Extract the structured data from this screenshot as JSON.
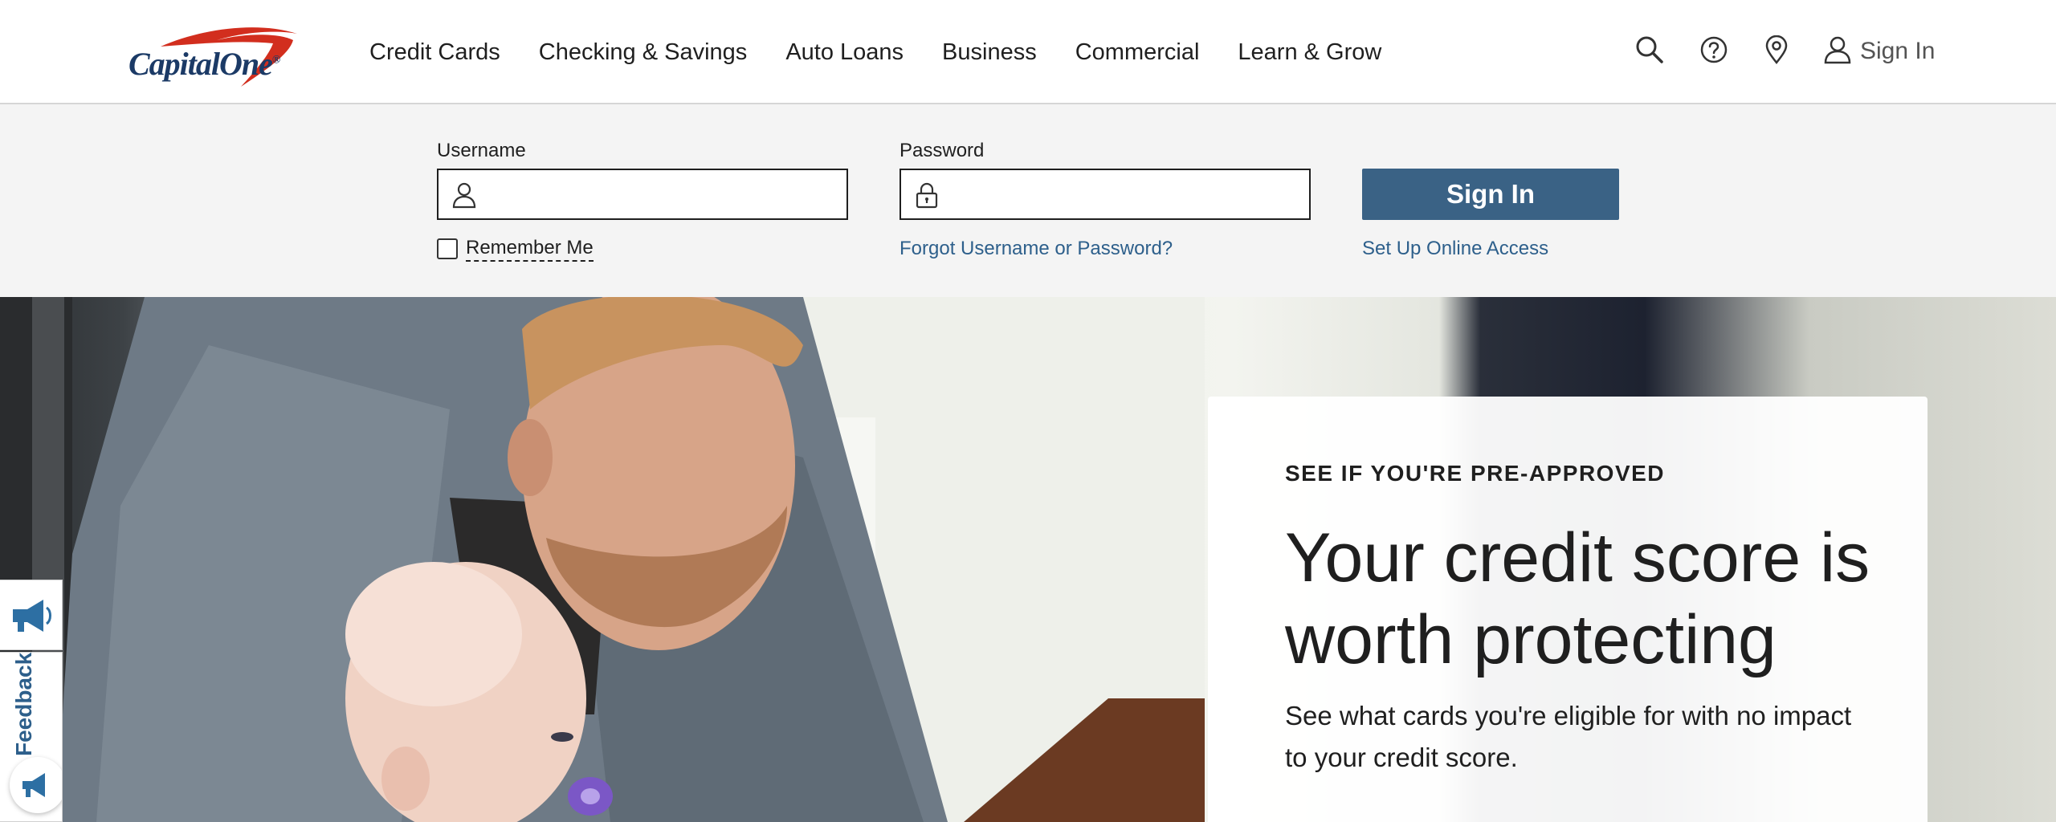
{
  "brand": {
    "logo_text": "Capital",
    "logo_text_2": "One",
    "logo_reg": "®",
    "colors": {
      "navy": "#1b3a66",
      "red": "#d22e1e",
      "button": "#3a6285",
      "link": "#2d5f8b",
      "login_bg": "#f4f4f4"
    }
  },
  "nav": {
    "items": [
      {
        "label": "Credit Cards"
      },
      {
        "label": "Checking & Savings"
      },
      {
        "label": "Auto Loans"
      },
      {
        "label": "Business"
      },
      {
        "label": "Commercial"
      },
      {
        "label": "Learn & Grow"
      }
    ]
  },
  "utility": {
    "icons": [
      "search-icon",
      "help-icon",
      "location-pin-icon",
      "user-icon"
    ],
    "signin_label": "Sign In"
  },
  "login": {
    "username_label": "Username",
    "username_value": "",
    "password_label": "Password",
    "password_value": "",
    "remember_label": "Remember Me",
    "remember_checked": false,
    "forgot_link": "Forgot Username or Password?",
    "setup_link": "Set Up Online Access",
    "signin_button": "Sign In"
  },
  "hero": {
    "eyebrow": "SEE IF YOU'RE PRE-APPROVED",
    "headline": "Your credit score is worth protecting",
    "subtext": "See what cards you're eligible for with no impact to your credit score."
  },
  "feedback": {
    "tab_label": "Feedback",
    "icon": "megaphone-icon"
  }
}
